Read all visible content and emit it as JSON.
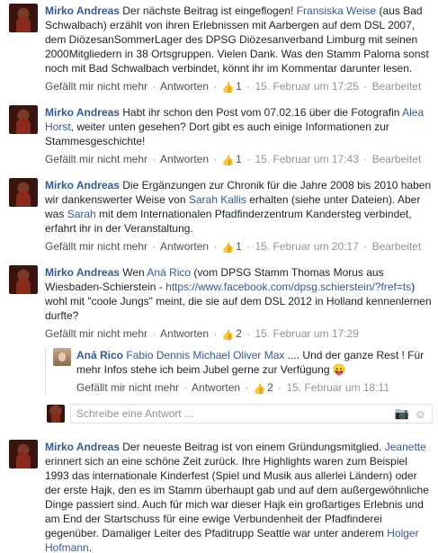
{
  "comments": [
    {
      "author": "Mirko Andreas",
      "parts": [
        " Der nächste Beitrag ist eingeflogen! ",
        "Fransiska Weise",
        " (aus Bad Schwalbach) erzählt von ihren Erlebnissen mit Aarbergen auf dem DSL 2007, dem DiözesanSommerLager des DPSG Diözesanverband Limburg mit seinen 2000Mitgliedern in 38 Ortsgruppen. Vielen Dank. Was den Stamm Paloma sonst noch mit Bad Schwalbach verbindet, könnt ihr im Kommentar darunter lesen."
      ],
      "likes": "1",
      "time": "15. Februar um 17:25",
      "edited": "Bearbeitet"
    },
    {
      "author": "Mirko Andreas",
      "parts": [
        " Habt ihr schon den Post vom 07.02.16 über die Fotografin ",
        "Alea Horst",
        ", weiter unten gesehen? Dort gibt es auch einige Informationen zur Stammesgeschichte!"
      ],
      "likes": "1",
      "time": "15. Februar um 17:43",
      "edited": "Bearbeitet"
    },
    {
      "author": "Mirko Andreas",
      "parts": [
        " Die Ergänzungen zur Chronik für die Jahre 2008 bis 2010 haben wir dankenswerter Weise von ",
        "Sarah Kallis",
        " erhalten (siehe unter Dateien). Aber was ",
        "Sarah",
        " mit dem Internationalen Pfadfinderzentrum Kandersteg verbindet, erfahrt ihr in der Veranstaltung."
      ],
      "likes": "1",
      "time": "15. Februar um 20:17",
      "edited": "Bearbeitet"
    },
    {
      "author": "Mirko Andreas",
      "parts": [
        " Wen ",
        "Aná Rico",
        " (vom DPSG Stamm Thomas Morus aus Wiesbaden-Schierstein - ",
        "https://www.facebook.com/dpsg.schierstein/?fref=ts",
        ") wohl mit \"coole Jungs\" meint, die sie auf dem DSL 2012 in Holland kennenlernen durfte?"
      ],
      "likes": "2",
      "time": "15. Februar um 17:29",
      "edited": ""
    },
    {
      "author": "Mirko Andreas",
      "parts": [
        " Der neueste Beitrag ist von einem Gründungsmitglied. ",
        "Jeanette",
        " erinnert sich an eine schöne Zeit zurück. Ihre Highlights waren zum Beispiel 1993 das internationale Kinderfest (Spiel und Musik aus allerlei Ländern) oder der erste Hajk, den es im Stamm überhaupt gab und auf dem außergewöhnliche Dinge passiert sind. Auch für mich war dieser Hajk ein großartiges Erlebnis und am End der Startschuss für eine ewige Verbundenheit der Pfadfinderei gegenüber. Damaliger Leiter des Pfaditrupp Seattle war unter anderem ",
        "Holger Hofmann",
        "."
      ]
    }
  ],
  "reply": {
    "author": "Aná Rico",
    "parts": [
      " ",
      "Fabio Dennis Michael Oliver Max",
      " .... Und der ganze Rest ! Für mehr Infos stehe ich beim Jubel gerne zur Verfügung ",
      "😛"
    ],
    "likes": "2",
    "time": "15. Februar um 18:11"
  },
  "actions": {
    "unlike": "Gefällt mir nicht mehr",
    "reply": "Antworten",
    "sep": "·"
  },
  "reply_box": {
    "placeholder": "Schreibe eine Antwort ...",
    "camera_icon": "camera-icon",
    "emoji_icon": "emoji-icon"
  },
  "colors": {
    "link": "#365899",
    "meta": "#90949c",
    "like": "#5890ff"
  }
}
